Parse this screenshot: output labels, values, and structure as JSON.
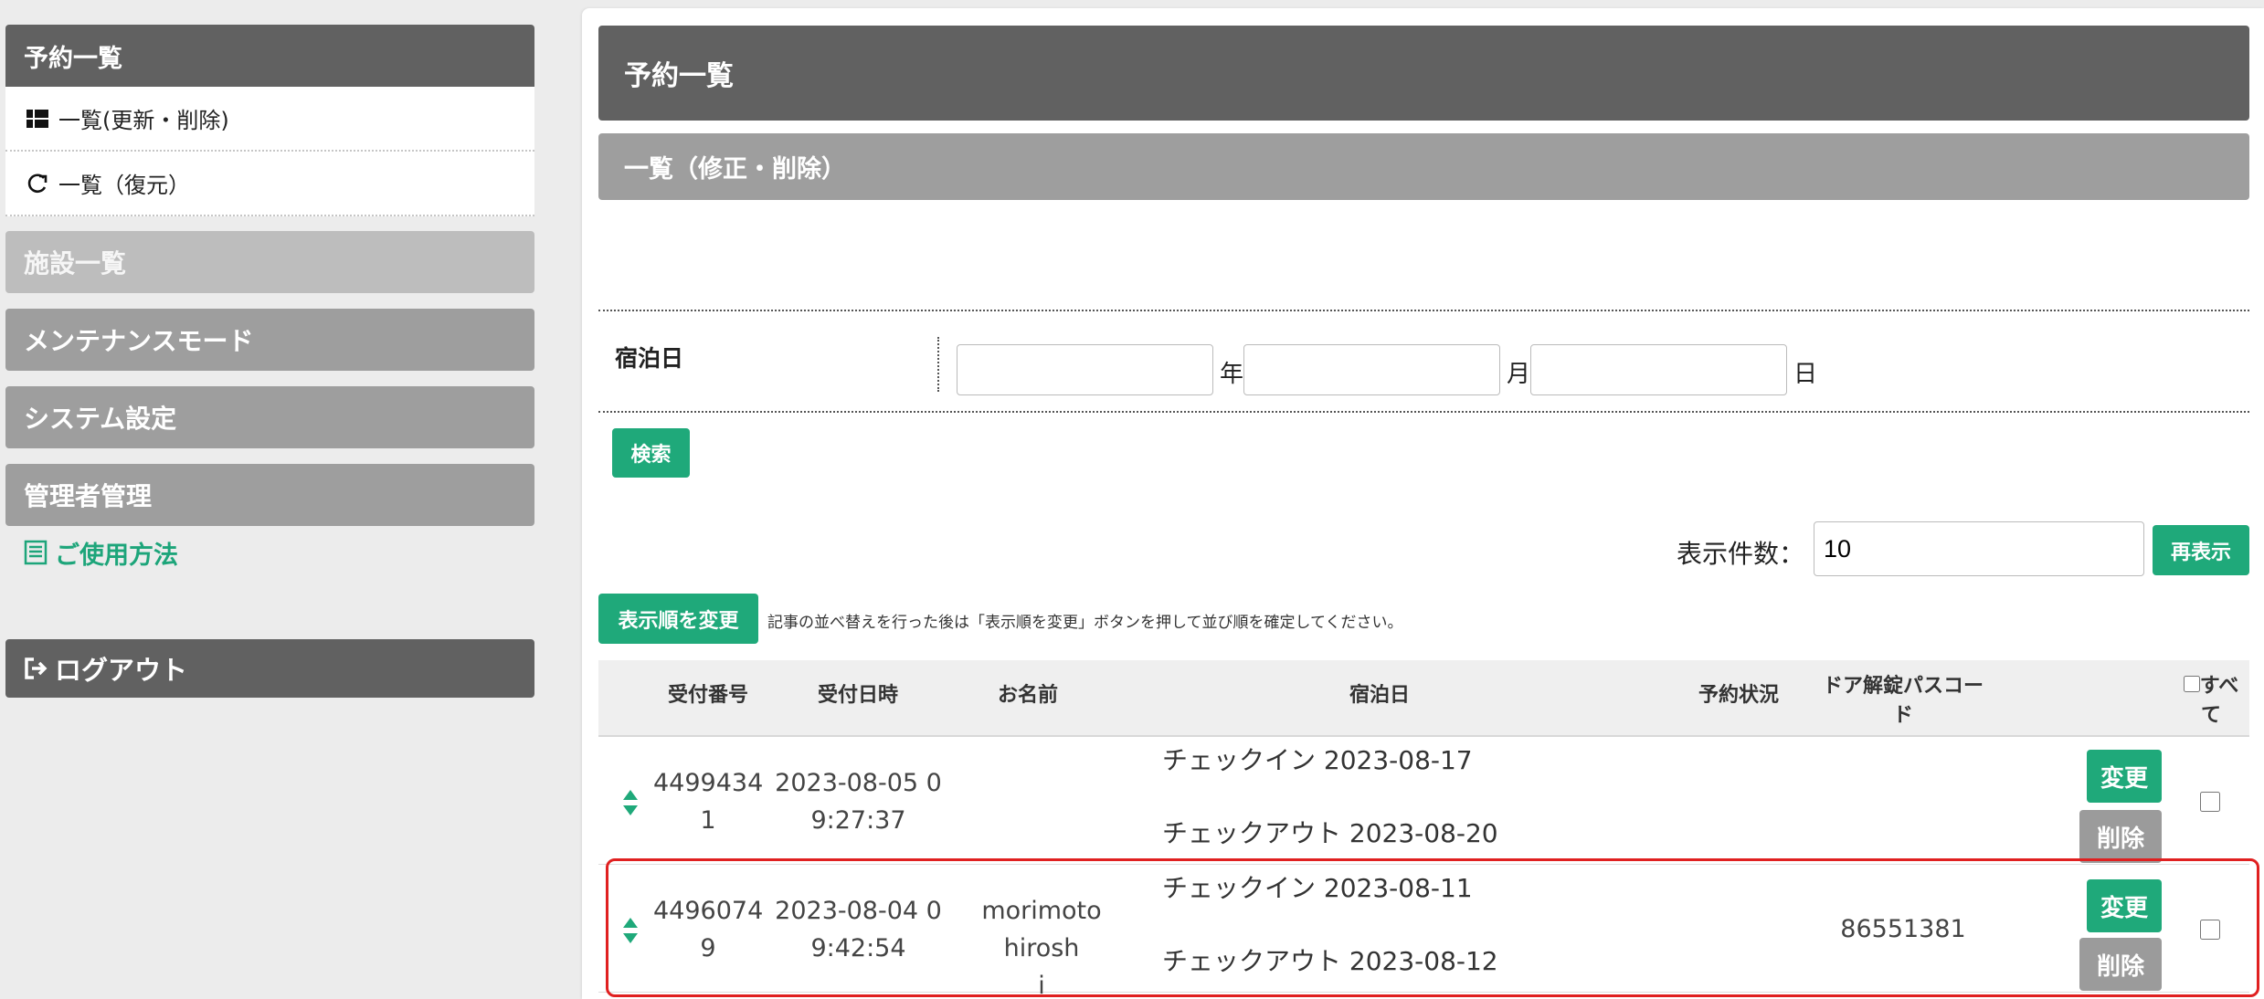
{
  "sidebar": {
    "reservations_header": "予約一覧",
    "reservations_list": "一覧(更新・削除)",
    "reservations_restore": "一覧（復元）",
    "facilities": "施設一覧",
    "maintenance": "メンテナンスモード",
    "system_settings": "システム設定",
    "admin_management": "管理者管理",
    "usage": "ご使用方法",
    "logout": "ログアウト"
  },
  "main": {
    "title": "予約一覧",
    "subtitle": "一覧（修正・削除）",
    "filter": {
      "label": "宿泊日",
      "year_value": "",
      "year_unit": "年",
      "month_value": "",
      "month_unit": "月",
      "day_value": "",
      "day_unit": "日",
      "search_button": "検索"
    },
    "display": {
      "count_label": "表示件数：",
      "count_value": "10",
      "redisplay_button": "再表示"
    },
    "order": {
      "button": "表示順を変更",
      "note": "記事の並べ替えを行った後は「表示順を変更」ボタンを押して並び順を確定してください。"
    },
    "table": {
      "headers": {
        "reception_no": "受付番号",
        "reception_datetime": "受付日時",
        "name": "お名前",
        "stay_date": "宿泊日",
        "status": "予約状況",
        "door_code_1": "ドア解錠パスコー",
        "door_code_2": "ド",
        "select_all_1": "すべ",
        "select_all_2": "て"
      },
      "rows": [
        {
          "no_1": "4499434",
          "no_2": "1",
          "dt_1": "2023-08-05 0",
          "dt_2": "9:27:37",
          "name_1": "",
          "name_2": "",
          "checkin": "チェックイン 2023-08-17",
          "checkout": "チェックアウト 2023-08-20",
          "status": "",
          "door_code": "",
          "edit": "変更",
          "delete": "削除"
        },
        {
          "no_1": "4496074",
          "no_2": "9",
          "dt_1": "2023-08-04 0",
          "dt_2": "9:42:54",
          "name_1": "morimoto hirosh",
          "name_2": "i",
          "checkin": "チェックイン 2023-08-11",
          "checkout": "チェックアウト 2023-08-12",
          "status": "",
          "door_code": "86551381",
          "edit": "変更",
          "delete": "削除"
        }
      ]
    }
  },
  "colors": {
    "accent_green": "#1fa97a",
    "dark_gray": "#616161",
    "mid_gray": "#9e9e9e",
    "light_gray": "#bdbdbd",
    "highlight_red": "#e02020"
  }
}
